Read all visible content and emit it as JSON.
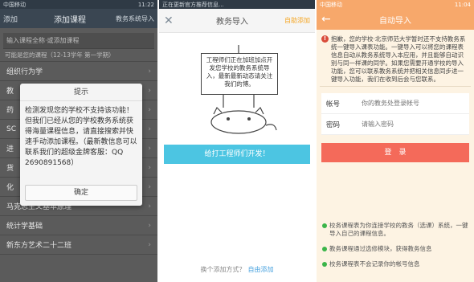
{
  "screen1": {
    "status": {
      "carrier": "中国移动",
      "time": "11:22"
    },
    "topbar": {
      "back": "添加",
      "title": "添加课程",
      "right": "教务系统导入"
    },
    "search_placeholder": "输入课程全称·或添加课程",
    "semester": "可能是您的课程（12-13学年 第一学期）",
    "courses": [
      {
        "label": "组织行为学"
      },
      {
        "label": "教"
      },
      {
        "label": "药"
      },
      {
        "label": "SC"
      },
      {
        "label": "进"
      },
      {
        "label": "货"
      },
      {
        "label": "化"
      },
      {
        "label": "马克思主义基本原理"
      },
      {
        "label": "统计学基础"
      },
      {
        "label": "新东方艺术二十二班"
      }
    ],
    "dialog": {
      "title": "提示",
      "message": "检测发现您的学校不支持该功能！但我们已经从您的学校教务系统获得海量课程信息，请直接搜索并快速手动添加课程。（最新教信息可以联系我们的超级金牌客服：QQ 2690891568）",
      "ok": "确定"
    }
  },
  "screen2": {
    "status": {
      "time": "正在更新官方推荐信息..."
    },
    "topbar": {
      "title": "教务导入",
      "right": "自助添加"
    },
    "sign_text": "工程师们正在加班加点开发您学校的教务系统导入，最新最新动态请关注我们的博。",
    "action": "给打工程师们开发！",
    "footer": {
      "prefix": "换个添加方式？",
      "link": "自由添加"
    }
  },
  "screen3": {
    "status": {
      "carrier": "中国移动",
      "time": "11:04"
    },
    "topbar": {
      "title": "自动导入"
    },
    "notice": "抱歉，您的学校·北京师范大学暂时还不支持教务系统一键导入课表功能。一键导入可以将您的课程表信息自动从教务系统导入本应用，并且能够自动识别与同一样课的同学。如果您需要开通学校的导入功能，您可以联系教务系统并把相关信息同步进一键导入功能，我们在收到后会与您联系。",
    "form": {
      "account_label": "帐号",
      "account_placeholder": "你的教务处登录帐号",
      "password_label": "密码",
      "password_placeholder": "请输入密码"
    },
    "login": "登　录",
    "tips": [
      "校务课程表为你连接学校的教务（选课）系统，一键导入自己的课程信息。",
      "教务课程通过选修模块，获得教务信息",
      "校务课程表不会记录你的帐号信息"
    ]
  }
}
